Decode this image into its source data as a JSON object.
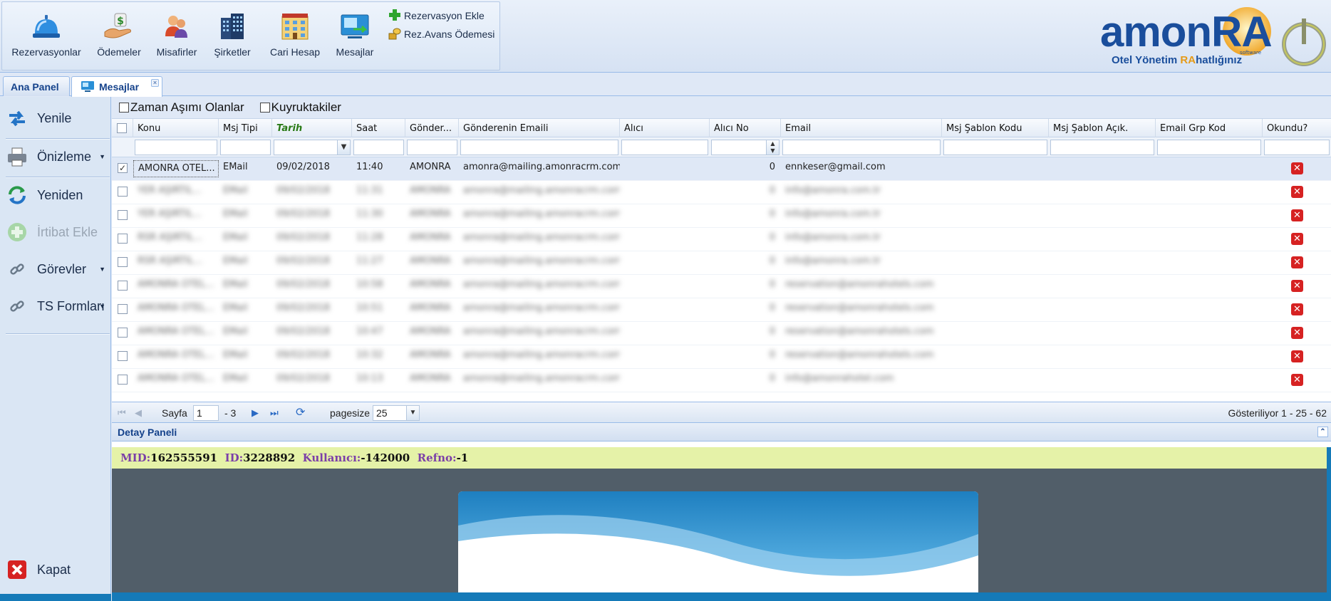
{
  "ribbon": {
    "buttons": [
      {
        "label": "Rezervasyonlar",
        "icon": "reception-bell-icon"
      },
      {
        "label": "Ödemeler",
        "icon": "payment-hand-icon"
      },
      {
        "label": "Misafirler",
        "icon": "guests-icon"
      },
      {
        "label": "Şirketler",
        "icon": "building-icon"
      },
      {
        "label": "Cari Hesap",
        "icon": "account-building-icon"
      },
      {
        "label": "Mesajlar",
        "icon": "messages-icon"
      }
    ],
    "small_buttons": [
      {
        "label": "Rezervasyon Ekle",
        "icon": "green-plus-icon"
      },
      {
        "label": "Rez.Avans Ödemesi",
        "icon": "coins-icon"
      }
    ]
  },
  "logo": {
    "word": "amonRA",
    "tagline_pre": "Otel Yönetim ",
    "tagline_hl": "RA",
    "tagline_post": "hatlığınız",
    "software": "software"
  },
  "tabs": [
    {
      "label": "Ana Panel",
      "active": false
    },
    {
      "label": "Mesajlar",
      "active": true
    }
  ],
  "left_panel": {
    "items": [
      {
        "label": "Yenile",
        "icon": "refresh-arrows-icon",
        "disabled": false,
        "arrow": false
      },
      {
        "label": "Önizleme",
        "icon": "printer-icon",
        "disabled": false,
        "arrow": true
      },
      {
        "label": "Yeniden",
        "icon": "resend-icon",
        "disabled": false,
        "arrow": false
      },
      {
        "label": "İrtibat Ekle",
        "icon": "add-contact-icon",
        "disabled": true,
        "arrow": false
      },
      {
        "label": "Görevler",
        "icon": "link-icon",
        "disabled": false,
        "arrow": true
      },
      {
        "label": "TS Formları",
        "icon": "link-icon",
        "disabled": false,
        "arrow": true
      }
    ],
    "close_label": "Kapat"
  },
  "filters": {
    "timeout_label": "Zaman Aşımı Olanlar",
    "queue_label": "Kuyruktakiler"
  },
  "grid": {
    "columns": [
      "Konu",
      "Msj Tipi",
      "Tarih",
      "Saat",
      "Gönder...",
      "Gönderenin Emaili",
      "Alıcı",
      "Alıcı No",
      "Email",
      "Msj Şablon Kodu",
      "Msj Şablon Açık.",
      "Email Grp Kod",
      "Okundu?"
    ],
    "sorted_column": "Tarih",
    "rows": [
      {
        "konu": "AMONRA OTEL...",
        "tip": "EMail",
        "tarih": "09/02/2018",
        "saat": "11:40",
        "gonderen": "AMONRA",
        "email_from": "amonra@mailing.amonracrm.com",
        "alici": "",
        "alici_no": "0",
        "email": "ennkeser@gmail.com",
        "checked": true,
        "selected": true,
        "blur": false
      },
      {
        "konu": "YER AŞIRTIL...",
        "tip": "EMail",
        "tarih": "09/02/2018",
        "saat": "11:31",
        "gonderen": "AMONRA",
        "email_from": "amonra@mailing.amonracrm.com",
        "alici": "",
        "alici_no": "0",
        "email": "info@amonra.com.tr",
        "checked": false,
        "selected": false,
        "blur": true
      },
      {
        "konu": "YER AŞIRTIL...",
        "tip": "EMail",
        "tarih": "09/02/2018",
        "saat": "11:30",
        "gonderen": "AMONRA",
        "email_from": "amonra@mailing.amonracrm.com",
        "alici": "",
        "alici_no": "0",
        "email": "info@amonra.com.tr",
        "checked": false,
        "selected": false,
        "blur": true
      },
      {
        "konu": "RSR AŞIRTIL...",
        "tip": "EMail",
        "tarih": "09/02/2018",
        "saat": "11:28",
        "gonderen": "AMONRA",
        "email_from": "amonra@mailing.amonracrm.com",
        "alici": "",
        "alici_no": "0",
        "email": "info@amonra.com.tr",
        "checked": false,
        "selected": false,
        "blur": true
      },
      {
        "konu": "RSR AŞIRTIL...",
        "tip": "EMail",
        "tarih": "09/02/2018",
        "saat": "11:27",
        "gonderen": "AMONRA",
        "email_from": "amonra@mailing.amonracrm.com",
        "alici": "",
        "alici_no": "0",
        "email": "info@amonra.com.tr",
        "checked": false,
        "selected": false,
        "blur": true
      },
      {
        "konu": "AMONRA OTEL...",
        "tip": "EMail",
        "tarih": "09/02/2018",
        "saat": "10:58",
        "gonderen": "AMONRA",
        "email_from": "amonra@mailing.amonracrm.com",
        "alici": "",
        "alici_no": "0",
        "email": "reservation@amonrahotels.com",
        "checked": false,
        "selected": false,
        "blur": true
      },
      {
        "konu": "AMONRA OTEL...",
        "tip": "EMail",
        "tarih": "09/02/2018",
        "saat": "10:51",
        "gonderen": "AMONRA",
        "email_from": "amonra@mailing.amonracrm.com",
        "alici": "",
        "alici_no": "0",
        "email": "reservation@amonrahotels.com",
        "checked": false,
        "selected": false,
        "blur": true
      },
      {
        "konu": "AMONRA OTEL...",
        "tip": "EMail",
        "tarih": "09/02/2018",
        "saat": "10:47",
        "gonderen": "AMONRA",
        "email_from": "amonra@mailing.amonracrm.com",
        "alici": "",
        "alici_no": "0",
        "email": "reservation@amonrahotels.com",
        "checked": false,
        "selected": false,
        "blur": true
      },
      {
        "konu": "AMONRA OTEL...",
        "tip": "EMail",
        "tarih": "09/02/2018",
        "saat": "10:32",
        "gonderen": "AMONRA",
        "email_from": "amonra@mailing.amonracrm.com",
        "alici": "",
        "alici_no": "0",
        "email": "reservation@amonrahotels.com",
        "checked": false,
        "selected": false,
        "blur": true
      },
      {
        "konu": "AMONRA OTEL...",
        "tip": "EMail",
        "tarih": "09/02/2018",
        "saat": "10:13",
        "gonderen": "AMONRA",
        "email_from": "amonra@mailing.amonracrm.com",
        "alici": "",
        "alici_no": "0",
        "email": "info@amonrahotel.com",
        "checked": false,
        "selected": false,
        "blur": true
      }
    ]
  },
  "pager": {
    "page_label": "Sayfa",
    "page_value": "1",
    "page_total": "- 3",
    "pagesize_label": "pagesize",
    "pagesize_value": "25",
    "showing": "Gösteriliyor 1 - 25 - 62"
  },
  "detail": {
    "title": "Detay Paneli",
    "mid_key": "MID:",
    "mid_val": "162555591",
    "id_key": "ID:",
    "id_val": "3228892",
    "user_key": "Kullanıcı:",
    "user_val": "-142000",
    "ref_key": "Refno:",
    "ref_val": "-1"
  },
  "colors": {
    "accent_blue": "#15428b",
    "panel_bg": "#dfe8f6",
    "info_bar": "#e5f2a8",
    "read_badge_red": "#d62222",
    "preview_bg": "#515e69"
  }
}
